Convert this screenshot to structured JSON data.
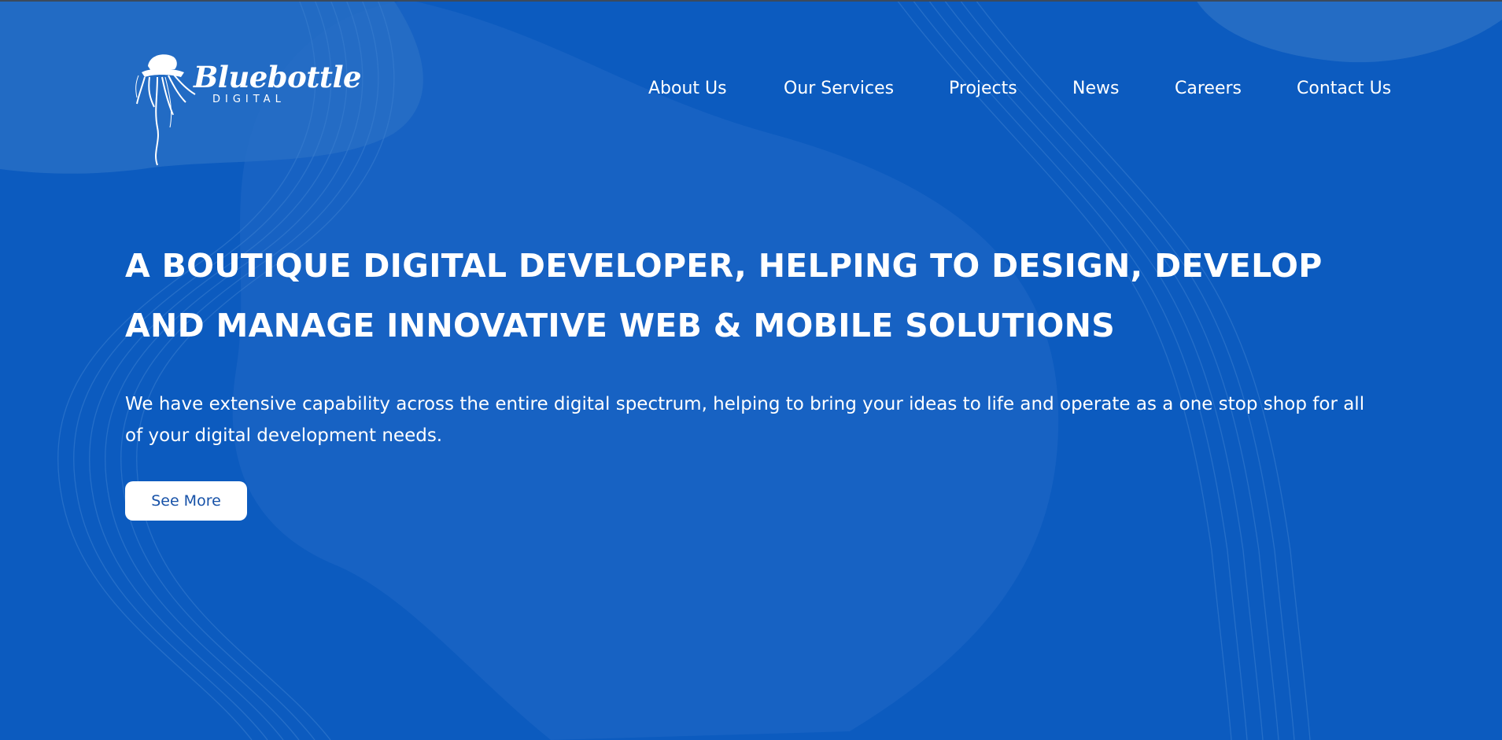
{
  "brand": {
    "name": "Bluebottle",
    "tagline": "DIGITAL",
    "logo_icon": "bluebottle-jellyfish-icon"
  },
  "nav": {
    "items": [
      {
        "label": "About Us"
      },
      {
        "label": "Our Services"
      },
      {
        "label": "Projects"
      },
      {
        "label": "News"
      },
      {
        "label": "Careers"
      },
      {
        "label": "Contact Us"
      }
    ]
  },
  "hero": {
    "title": "A BOUTIQUE DIGITAL DEVELOPER, HELPING TO DESIGN, DEVELOP AND MANAGE INNOVATIVE WEB & MOBILE SOLUTIONS",
    "text": "We have extensive capability across the entire digital spectrum, helping to bring your ideas to life and operate as a one stop shop for all of your digital development needs.",
    "cta_label": "See More"
  },
  "colors": {
    "background": "#0c5bbf",
    "blob": "#1a67c4",
    "button_text": "#1752a8",
    "foreground": "#ffffff"
  }
}
